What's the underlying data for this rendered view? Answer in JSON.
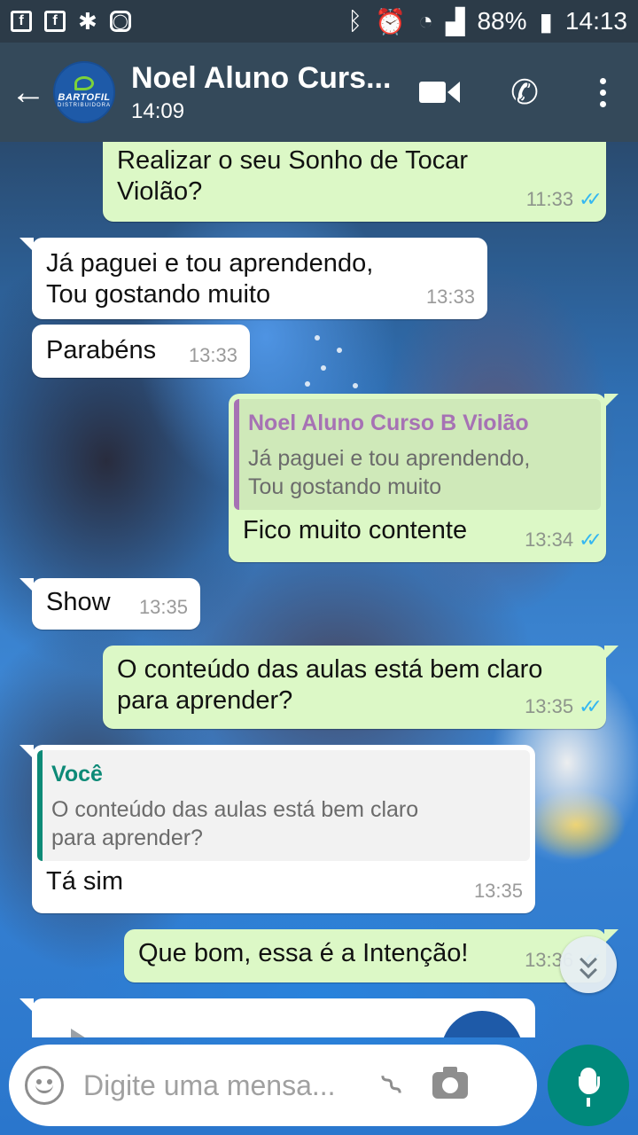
{
  "status_bar": {
    "battery": "88%",
    "time": "14:13"
  },
  "header": {
    "contact_name": "Noel Aluno Curs...",
    "last_seen": "14:09",
    "avatar_brand": "BARTOFIL",
    "avatar_subtitle": "DISTRIBUIDORA"
  },
  "messages": [
    {
      "direction": "out",
      "text_lines": [
        "Realizar o seu Sonho de Tocar",
        "Violão?"
      ],
      "time": "11:33",
      "ticks": "✓✓"
    },
    {
      "direction": "in",
      "text_lines": [
        "Já paguei e tou aprendendo,",
        "Tou gostando muito"
      ],
      "time": "13:33"
    },
    {
      "direction": "in",
      "text_lines": [
        "Parabéns"
      ],
      "time": "13:33"
    },
    {
      "direction": "out",
      "quote": {
        "author": "Noel Aluno Curso B Violão",
        "text_lines": [
          "Já paguei e tou aprendendo,",
          "Tou gostando muito"
        ]
      },
      "text_lines": [
        "Fico muito contente"
      ],
      "time": "13:34",
      "ticks": "✓✓"
    },
    {
      "direction": "in",
      "text_lines": [
        "Show"
      ],
      "time": "13:35"
    },
    {
      "direction": "out",
      "text_lines": [
        "O conteúdo das aulas está bem claro",
        "para aprender?"
      ],
      "time": "13:35",
      "ticks": "✓✓"
    },
    {
      "direction": "in",
      "quote": {
        "author": "Você",
        "text_lines": [
          "O conteúdo das aulas está bem claro",
          "para aprender?"
        ]
      },
      "text_lines": [
        "Tá sim"
      ],
      "time": "13:35"
    },
    {
      "direction": "out",
      "text_lines": [
        "Que bom, essa é a Intenção!"
      ],
      "time": "13:36",
      "ticks": "✓✓"
    }
  ],
  "input": {
    "placeholder": "Digite uma mensa..."
  },
  "icons": {
    "back": "arrow-left-icon",
    "video": "video-call-icon",
    "phone": "phone-icon",
    "more": "more-vert-icon",
    "emoji": "emoji-icon",
    "attach": "paperclip-icon",
    "camera": "camera-icon",
    "mic": "mic-icon",
    "scroll": "chevron-double-down-icon"
  },
  "colors": {
    "header": "#34495a",
    "status_bar": "#2c3b48",
    "outgoing_bubble": "#dcf8c6",
    "incoming_bubble": "#ffffff",
    "read_ticks": "#34b7f1",
    "mic_button": "#00897b"
  }
}
